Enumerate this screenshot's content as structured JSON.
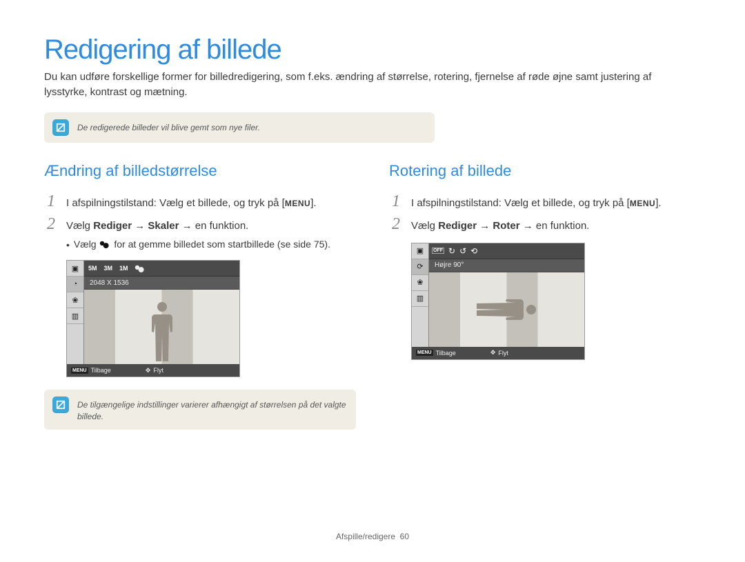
{
  "title": "Redigering af billede",
  "intro": "Du kan udføre forskellige former for billedredigering, som f.eks. ændring af størrelse, rotering, fjernelse af røde øjne samt justering af lysstyrke, kontrast og mætning.",
  "note1": "De redigerede billeder vil blive gemt som nye filer.",
  "left": {
    "heading": "Ændring af billedstørrelse",
    "step1_pre": "I afspilningstilstand: Vælg et billede, og tryk på [",
    "step1_menu": "MENU",
    "step1_post": "].",
    "step2_pre": "Vælg ",
    "step2_b1": "Rediger",
    "step2_arrow": " → ",
    "step2_b2": "Skaler",
    "step2_post": " → en funktion.",
    "bullet_pre": "Vælg ",
    "bullet_post": " for at gemme billedet som startbillede (se side 75).",
    "screenshot": {
      "toolbar_items": [
        "5M",
        "3M",
        "1M"
      ],
      "label": "2048 X 1536",
      "footer_back_tag": "MENU",
      "footer_back": "Tilbage",
      "footer_move": "Flyt"
    },
    "note2": "De tilgængelige indstillinger varierer afhængigt af størrelsen på det valgte billede."
  },
  "right": {
    "heading": "Rotering af billede",
    "step1_pre": "I afspilningstilstand: Vælg et billede, og tryk på [",
    "step1_menu": "MENU",
    "step1_post": "].",
    "step2_pre": "Vælg ",
    "step2_b1": "Rediger",
    "step2_arrow": " → ",
    "step2_b2": "Roter",
    "step2_post": " → en funktion.",
    "screenshot": {
      "label": "Højre 90°",
      "footer_back_tag": "MENU",
      "footer_back": "Tilbage",
      "footer_move": "Flyt"
    }
  },
  "footer": {
    "section": "Afspille/redigere",
    "page": "60"
  }
}
